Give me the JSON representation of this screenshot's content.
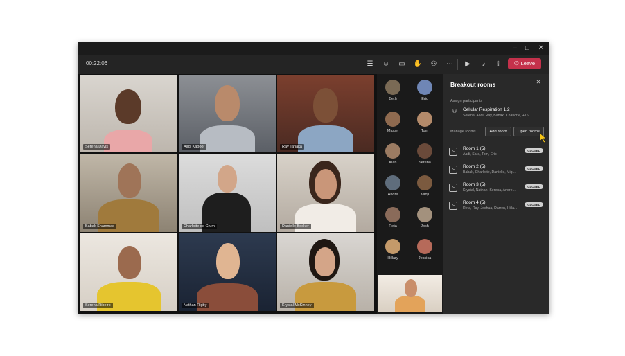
{
  "meeting": {
    "timer": "00:22:06",
    "leave_label": "Leave"
  },
  "video_tiles": [
    {
      "name": "Serena Davis"
    },
    {
      "name": "Aadi Kapoor"
    },
    {
      "name": "Ray Tanaka"
    },
    {
      "name": "Babak Shammas"
    },
    {
      "name": "Charlotte de Crum"
    },
    {
      "name": "Danielle Booker"
    },
    {
      "name": "Serena Ribeiro"
    },
    {
      "name": "Nathan Rigby"
    },
    {
      "name": "Krystal McKinney"
    }
  ],
  "roster": [
    {
      "name": "Beth"
    },
    {
      "name": "Eric"
    },
    {
      "name": "Miguel"
    },
    {
      "name": "Tom"
    },
    {
      "name": "Kian"
    },
    {
      "name": "Serena"
    },
    {
      "name": "Andre"
    },
    {
      "name": "Kadji"
    },
    {
      "name": "Reta"
    },
    {
      "name": "Josh"
    },
    {
      "name": "Hillary"
    },
    {
      "name": "Jessica"
    }
  ],
  "breakout": {
    "title": "Breakout rooms",
    "assign_label": "Assign participants",
    "meeting_name": "Cellular Respiration 1.2",
    "meeting_people": "Serena, Aadi, Ray, Babak, Charlotte, +16",
    "manage_label": "Manage rooms",
    "add_room": "Add room",
    "open_rooms": "Open rooms",
    "rooms": [
      {
        "title": "Room 1 (5)",
        "people": "Aadi, Sara, Tom, Eric",
        "status": "CLOSED"
      },
      {
        "title": "Room 2 (5)",
        "people": "Babak, Charlotte, Danielle, Mig...",
        "status": "CLOSED"
      },
      {
        "title": "Room 3 (5)",
        "people": "Krystal, Nathan, Serena, Andre...",
        "status": "CLOSED"
      },
      {
        "title": "Room 4 (5)",
        "people": "Reta, Ray, Joshua, Darren, Hilla...",
        "status": "CLOSED"
      }
    ]
  },
  "colors": {
    "accent_leave": "#c4314b",
    "cursor": "#f5c518"
  }
}
